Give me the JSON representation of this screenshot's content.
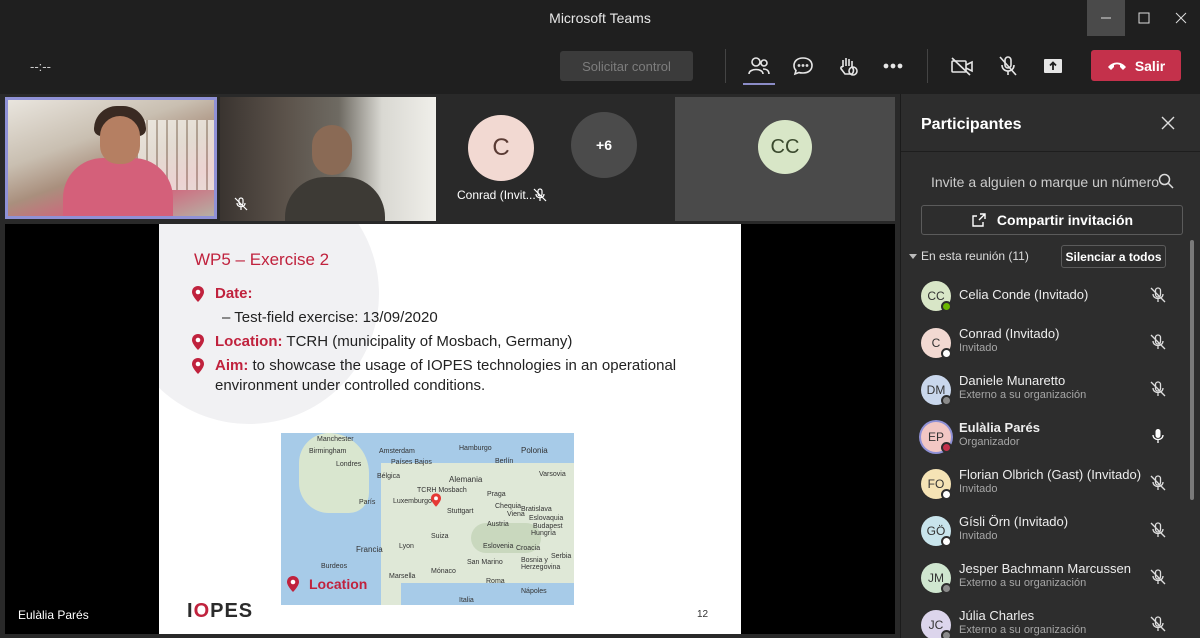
{
  "window": {
    "title": "Microsoft Teams"
  },
  "toolbar": {
    "timer": "--:--",
    "request_control": "Solicitar control",
    "leave": "Salir"
  },
  "stage": {
    "tile_conrad_label": "Conrad (Invit...",
    "tile_conrad_initial": "C",
    "tile_more": "+6",
    "tile_cc_initials": "CC",
    "presenter_name": "Eulàlia Parés"
  },
  "slide": {
    "title": "WP5 – Exercise 2",
    "date_label": "Date:",
    "date_sub": "–  Test-field exercise: 13/09/2020",
    "location_label": "Location:",
    "location_text": "TCRH (municipality of Mosbach, Germany)",
    "aim_label": "Aim:",
    "aim_text": "to showcase the usage of IOPES technologies in an operational",
    "aim_text2": "environment under controlled conditions.",
    "map_location_label": "Location",
    "map_pin_label": "TCRH Mosbach",
    "map_places": [
      "Manchester",
      "Birmingham",
      "Londres",
      "Amsterdam",
      "Países Bajos",
      "Bélgica",
      "Luxemburgo",
      "París",
      "Alemania",
      "Berlín",
      "Polonia",
      "Praga",
      "Chequia",
      "Eslovaquia",
      "Austria",
      "Hungría",
      "Suiza",
      "Francia",
      "Croacia",
      "Bosnia y Herzegovina",
      "Italia",
      "Mónaco",
      "Lyon",
      "Serbia",
      "Roma",
      "Varsovia",
      "Bratislava",
      "Stuttgart",
      "Viena",
      "Budapest",
      "Marsella",
      "San Marino",
      "Eslovenia",
      "Nápoles",
      "Hamburgo",
      "Burdeos"
    ],
    "page_number": "12",
    "logo_pre": "I",
    "logo_o": "O",
    "logo_post": "PES"
  },
  "panel": {
    "title": "Participantes",
    "invite_placeholder": "Invite a alguien o marque un número",
    "share_invitation": "Compartir invitación",
    "in_meeting": "En esta reunión (11)",
    "mute_all": "Silenciar a todos",
    "participants": [
      {
        "initials": "CC",
        "name": "Celia Conde (Invitado)",
        "role": "",
        "avatar_color": "#d8e6c7",
        "status_color": "#6bb700",
        "mic": "off"
      },
      {
        "initials": "C",
        "name": "Conrad (Invitado)",
        "role": "Invitado",
        "avatar_color": "#f2d9d2",
        "status_color": "#ffffff",
        "mic": "off"
      },
      {
        "initials": "DM",
        "name": "Daniele Munaretto",
        "role": "Externo a su organización",
        "avatar_color": "#c9d7ec",
        "status_color": "#8a8a8a",
        "mic": "off"
      },
      {
        "initials": "EP",
        "name": "Eulàlia Parés",
        "role": "Organizador",
        "avatar_color": "#f2c7c4",
        "status_color": "#c4314b",
        "mic": "on"
      },
      {
        "initials": "FO",
        "name": "Florian Olbrich (Gast) (Invitado)",
        "role": "Invitado",
        "avatar_color": "#f5e3b5",
        "status_color": "#ffffff",
        "mic": "off"
      },
      {
        "initials": "GÖ",
        "name": "Gísli Örn (Invitado)",
        "role": "Invitado",
        "avatar_color": "#c8e4ec",
        "status_color": "#ffffff",
        "mic": "off"
      },
      {
        "initials": "JM",
        "name": "Jesper Bachmann Marcussen",
        "role": "Externo a su organización",
        "avatar_color": "#cfe6cf",
        "status_color": "#8a8a8a",
        "mic": "off"
      },
      {
        "initials": "JC",
        "name": "Júlia Charles",
        "role": "Externo a su organización",
        "avatar_color": "#dcd5ec",
        "status_color": "#8a8a8a",
        "mic": "off"
      }
    ]
  }
}
